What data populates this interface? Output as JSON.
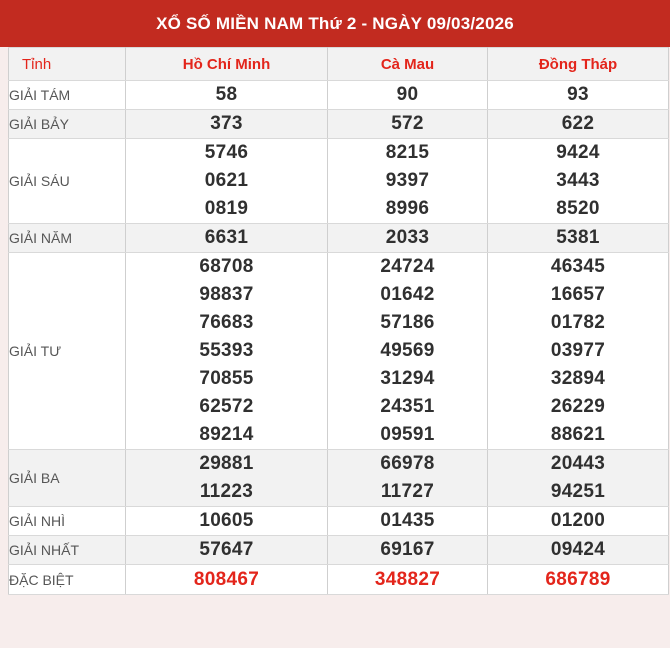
{
  "title": "XỔ SỐ MIỀN NAM Thứ 2 - NGÀY 09/03/2026",
  "colors": {
    "title_bar_bg": "#c22b20",
    "accent_red": "#e3251b",
    "number_gray": "#303030",
    "stripe_gray": "#f2f2f2",
    "page_bg_pink": "#f7edec"
  },
  "table": {
    "province_header": "Tỉnh",
    "columns": [
      "Hồ Chí Minh",
      "Cà Mau",
      "Đồng Tháp"
    ],
    "rows": [
      {
        "label": "GIẢI TÁM",
        "cols": [
          [
            "58"
          ],
          [
            "90"
          ],
          [
            "93"
          ]
        ]
      },
      {
        "label": "GIẢI BẢY",
        "cols": [
          [
            "373"
          ],
          [
            "572"
          ],
          [
            "622"
          ]
        ]
      },
      {
        "label": "GIẢI SÁU",
        "cols": [
          [
            "5746",
            "0621",
            "0819"
          ],
          [
            "8215",
            "9397",
            "8996"
          ],
          [
            "9424",
            "3443",
            "8520"
          ]
        ]
      },
      {
        "label": "GIẢI NĂM",
        "cols": [
          [
            "6631"
          ],
          [
            "2033"
          ],
          [
            "5381"
          ]
        ]
      },
      {
        "label": "GIẢI TƯ",
        "cols": [
          [
            "68708",
            "98837",
            "76683",
            "55393",
            "70855",
            "62572",
            "89214"
          ],
          [
            "24724",
            "01642",
            "57186",
            "49569",
            "31294",
            "24351",
            "09591"
          ],
          [
            "46345",
            "16657",
            "01782",
            "03977",
            "32894",
            "26229",
            "88621"
          ]
        ]
      },
      {
        "label": "GIẢI BA",
        "cols": [
          [
            "29881",
            "11223"
          ],
          [
            "66978",
            "11727"
          ],
          [
            "20443",
            "94251"
          ]
        ]
      },
      {
        "label": "GIẢI NHÌ",
        "cols": [
          [
            "10605"
          ],
          [
            "01435"
          ],
          [
            "01200"
          ]
        ]
      },
      {
        "label": "GIẢI NHẤT",
        "cols": [
          [
            "57647"
          ],
          [
            "69167"
          ],
          [
            "09424"
          ]
        ]
      },
      {
        "label": "ĐẶC BIỆT",
        "special": true,
        "cols": [
          [
            "808467"
          ],
          [
            "348827"
          ],
          [
            "686789"
          ]
        ]
      }
    ]
  }
}
